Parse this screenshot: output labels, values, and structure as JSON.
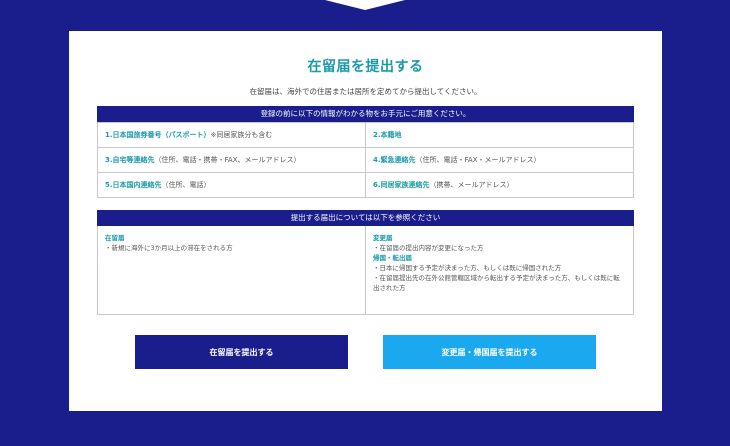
{
  "header": {
    "title": "在留届を提出する",
    "subtitle": "在留届は、海外での住居または居所を定めてから提出してください。"
  },
  "prep_section": {
    "bar_label": "登録の前に以下の情報がわかる物をお手元にご用意ください。",
    "items": [
      {
        "label": "1.日本国旅券番号（パスポート）",
        "note": "※同居家族分も含む"
      },
      {
        "label": "2.本籍地",
        "note": ""
      },
      {
        "label": "3.自宅等連絡先",
        "note": "（住所、電話・携帯・FAX、メールアドレス）"
      },
      {
        "label": "4.緊急連絡先",
        "note": "（住所、電話・FAX・メールアドレス）"
      },
      {
        "label": "5.日本国内連絡先",
        "note": "（住所、電話）"
      },
      {
        "label": "6.同居家族連絡先",
        "note": "（携帯、メールアドレス）"
      }
    ]
  },
  "submit_section": {
    "bar_label": "提出する届出については以下を参照ください",
    "left": {
      "heading": "在留届",
      "line1": "・新規に海外に3か月以上の滞在をされる方"
    },
    "right": {
      "heading1": "変更届",
      "line1": "・在留届の提出内容が変更になった方",
      "heading2": "帰国・転出届",
      "line2": "・日本に帰国する予定が決まった方、もしくは既に帰国された方",
      "line3": "・在留届提出先の在外公館管轄区域から転出する予定が決まった方、もしくは既に転出された方"
    }
  },
  "buttons": {
    "primary": "在留届を提出する",
    "secondary": "変更届・帰国届を提出する"
  },
  "colors": {
    "brand_navy": "#1a1d8c",
    "accent_teal": "#1b9aa8",
    "accent_sky": "#1aa9ee"
  }
}
